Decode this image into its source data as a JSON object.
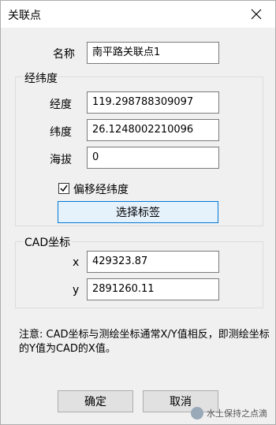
{
  "window": {
    "title": "关联点"
  },
  "name": {
    "label": "名称",
    "value": "南平路关联点1"
  },
  "latlon_group": {
    "title": "经纬度",
    "longitude_label": "经度",
    "longitude_value": "119.298788309097",
    "latitude_label": "纬度",
    "latitude_value": "26.1248002210096",
    "altitude_label": "海拔",
    "altitude_value": "0",
    "offset_label": "偏移经纬度",
    "offset_checked": true,
    "select_button": "选择标签"
  },
  "cad_group": {
    "title": "CAD坐标",
    "x_label": "x",
    "x_value": "429323.87",
    "y_label": "y",
    "y_value": "2891260.11"
  },
  "note": "注意: CAD坐标与测绘坐标通常X/Y值相反，即测绘坐标的Y值为CAD的X值。",
  "buttons": {
    "ok": "确定",
    "cancel": "取消"
  },
  "watermark": "水土保持之点滴"
}
